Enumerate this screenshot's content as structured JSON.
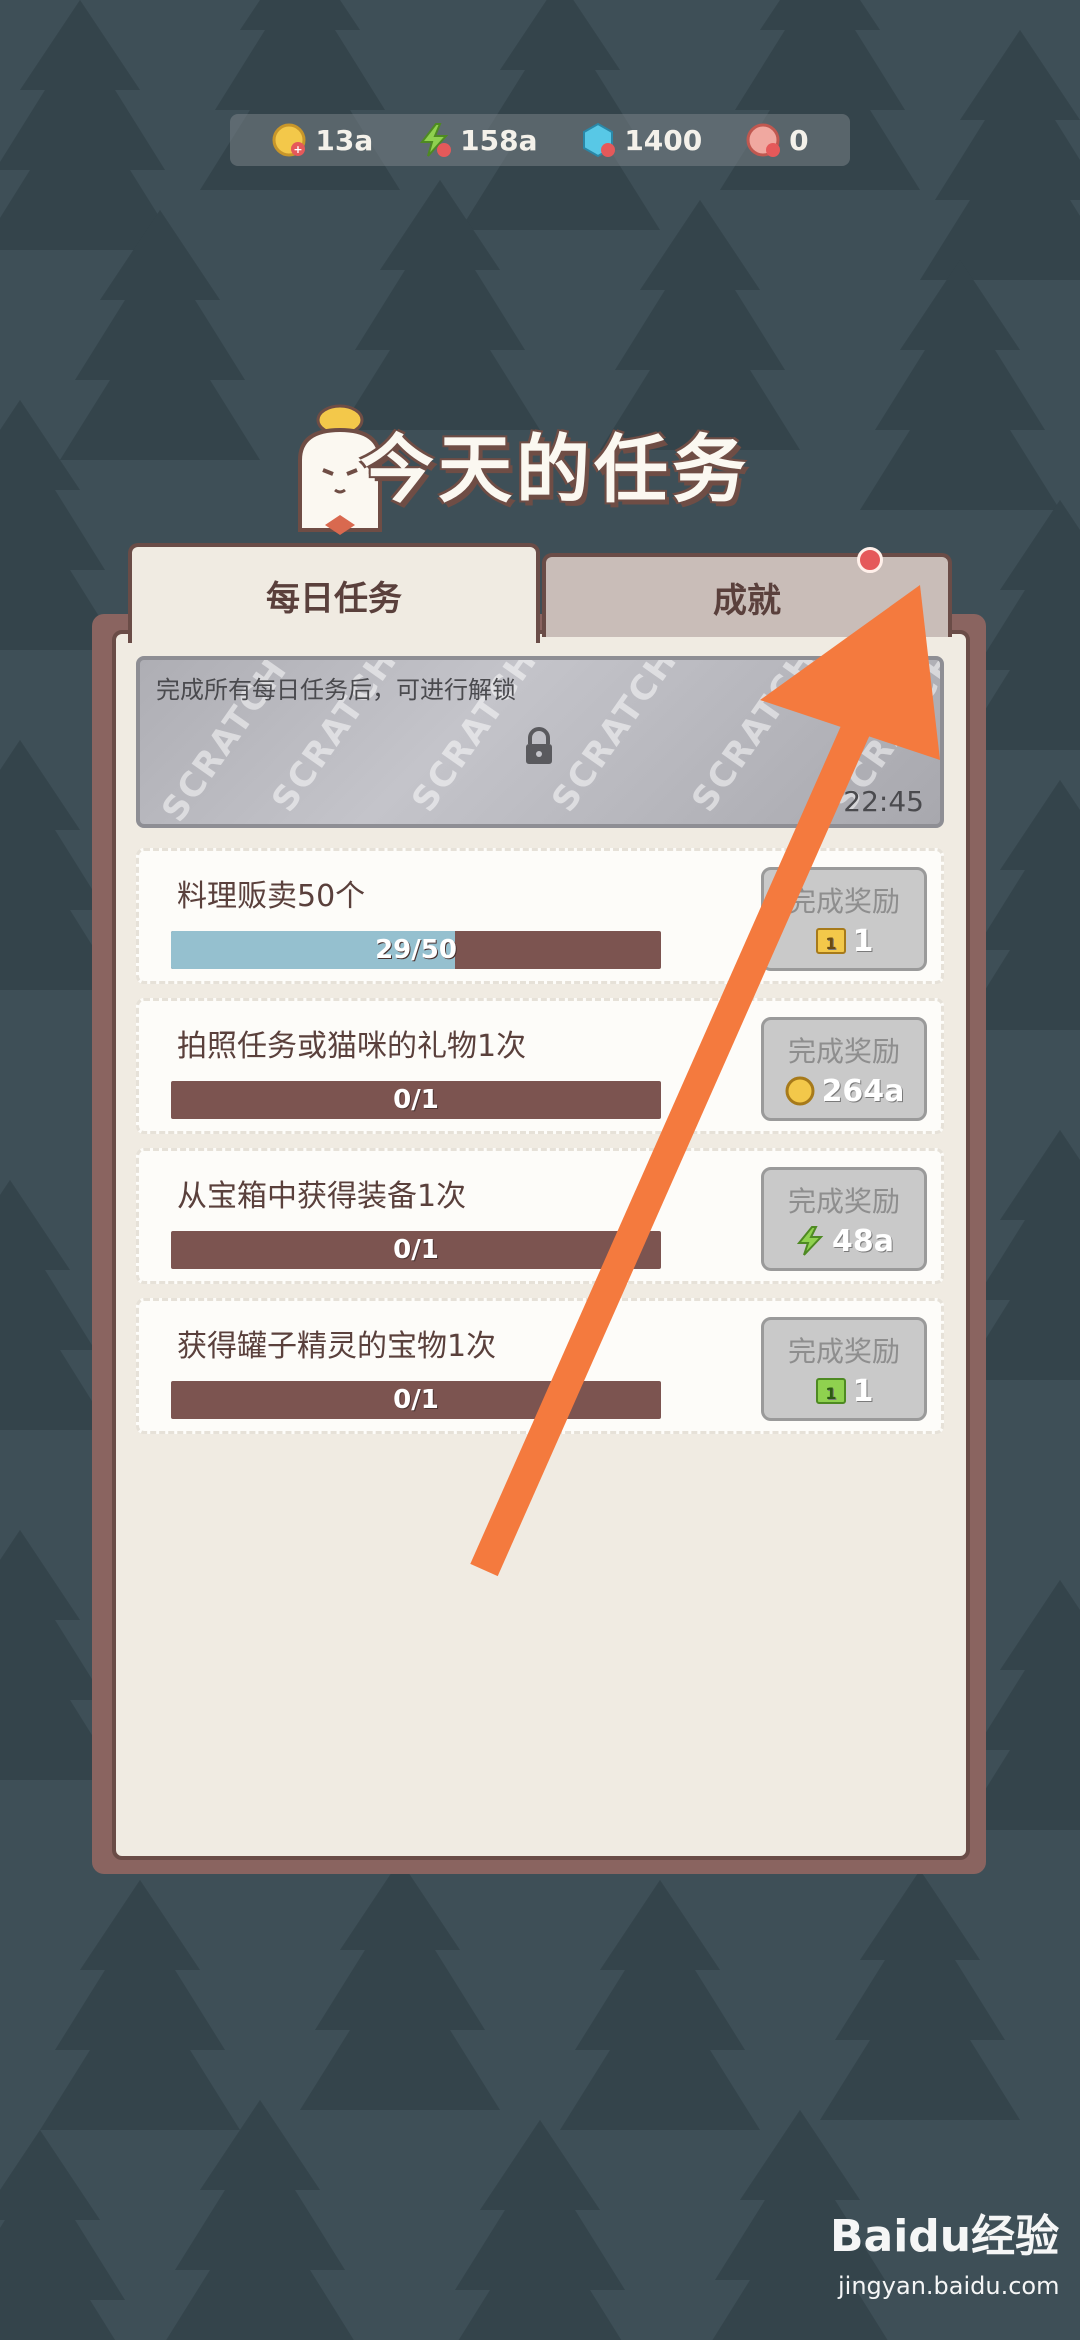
{
  "currency": [
    {
      "icon": "gold-coin-icon",
      "value": "13a"
    },
    {
      "icon": "lightning-icon",
      "value": "158a"
    },
    {
      "icon": "gem-icon",
      "value": "1400"
    },
    {
      "icon": "ticket-icon",
      "value": "0"
    }
  ],
  "title": "今天的任务",
  "tabs": {
    "daily": "每日任务",
    "achievements": "成就"
  },
  "scratch": {
    "text": "完成所有每日任务后，可进行解锁",
    "watermark": "SCRATCH",
    "timer": "22:45"
  },
  "tasks": [
    {
      "title": "料理贩卖50个",
      "progress_text": "29/50",
      "progress": 0.58,
      "reward_label": "完成奖励",
      "reward_icon": "ticket-gold-icon",
      "reward_amount": "1"
    },
    {
      "title": "拍照任务或猫咪的礼物1次",
      "progress_text": "0/1",
      "progress": 0,
      "reward_label": "完成奖励",
      "reward_icon": "gold-coin-icon",
      "reward_amount": "264a"
    },
    {
      "title": "从宝箱中获得装备1次",
      "progress_text": "0/1",
      "progress": 0,
      "reward_label": "完成奖励",
      "reward_icon": "lightning-icon",
      "reward_amount": "48a"
    },
    {
      "title": "获得罐子精灵的宝物1次",
      "progress_text": "0/1",
      "progress": 0,
      "reward_label": "完成奖励",
      "reward_icon": "ticket-green-icon",
      "reward_amount": "1"
    }
  ],
  "watermark": {
    "logo": "Baidu经验",
    "url": "jingyan.baidu.com"
  },
  "colors": {
    "background": "#3e4f57",
    "panel": "#f0ebe2",
    "panel_border": "#6a4c47",
    "bar_track": "#7c5450",
    "bar_fill": "#95c0cf",
    "arrow": "#f47a3e",
    "notification_dot": "#e5595a"
  }
}
